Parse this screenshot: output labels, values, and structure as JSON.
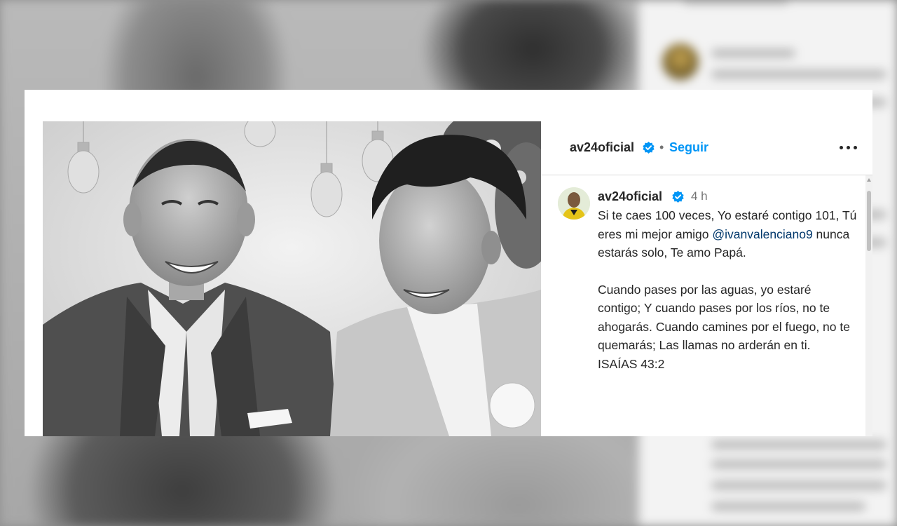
{
  "post": {
    "header": {
      "username": "av24oficial",
      "separator": "•",
      "follow_label": "Seguir",
      "more_icon": "more-horizontal-icon"
    },
    "caption": {
      "username": "av24oficial",
      "time": "4 h",
      "paragraph1_part1": "Si te caes 100 veces, Yo estaré contigo 101, Tú eres mi mejor amigo",
      "mention": "@ivanvalenciano9",
      "paragraph1_part2": " nunca estarás solo, Te amo Papá.",
      "paragraph2": "Cuando pases por las aguas, yo estaré contigo; Y cuando pases por los ríos, no te ahogarás. Cuando camines por el fuego, no te quemarás; Las llamas no arderán en ti.",
      "reference": "ISAÍAS 43:2"
    }
  },
  "colors": {
    "link_blue": "#0095f6",
    "verified_blue": "#0095f6",
    "mention": "#00376b",
    "text": "#262626",
    "muted": "#737373"
  }
}
